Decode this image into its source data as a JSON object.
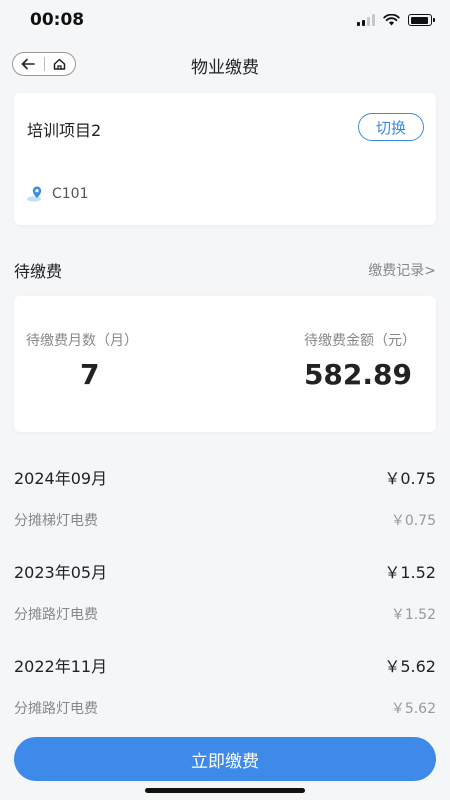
{
  "status_bar": {
    "time": "00:08"
  },
  "nav": {
    "title": "物业缴费"
  },
  "project": {
    "name": "培训项目2",
    "switch_label": "切换",
    "room": "C101"
  },
  "pending": {
    "section_title": "待缴费",
    "records_link": "缴费记录>",
    "months_label": "待缴费月数（月）",
    "amount_label": "待缴费金额（元）",
    "months_value": "7",
    "amount_value": "582.89"
  },
  "bills": [
    {
      "month": "2024年09月",
      "amount": "￥0.75",
      "item": "分摊梯灯电费",
      "item_amount": "￥0.75"
    },
    {
      "month": "2023年05月",
      "amount": "￥1.52",
      "item": "分摊路灯电费",
      "item_amount": "￥1.52"
    },
    {
      "month": "2022年11月",
      "amount": "￥5.62",
      "item": "分摊路灯电费",
      "item_amount": "￥5.62"
    }
  ],
  "pay_button": "立即缴费",
  "colors": {
    "accent": "#3e8ae9",
    "background": "#f5f6f8"
  }
}
